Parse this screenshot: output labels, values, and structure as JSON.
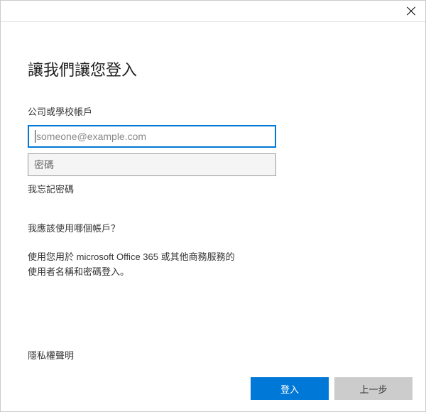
{
  "title": "讓我們讓您登入",
  "account_label": "公司或學校帳戶",
  "email_placeholder": "someone@example.com",
  "password_placeholder": "密碼",
  "forgot_password": "我忘記密碼",
  "which_account": "我應該使用哪個帳戶？",
  "description_line1": "使用您用於 microsoft Office 365 或其他商務服務的",
  "description_line2": "使用者名稱和密碼登入。",
  "privacy": "隱私權聲明",
  "buttons": {
    "signin": "登入",
    "back": "上一步"
  }
}
